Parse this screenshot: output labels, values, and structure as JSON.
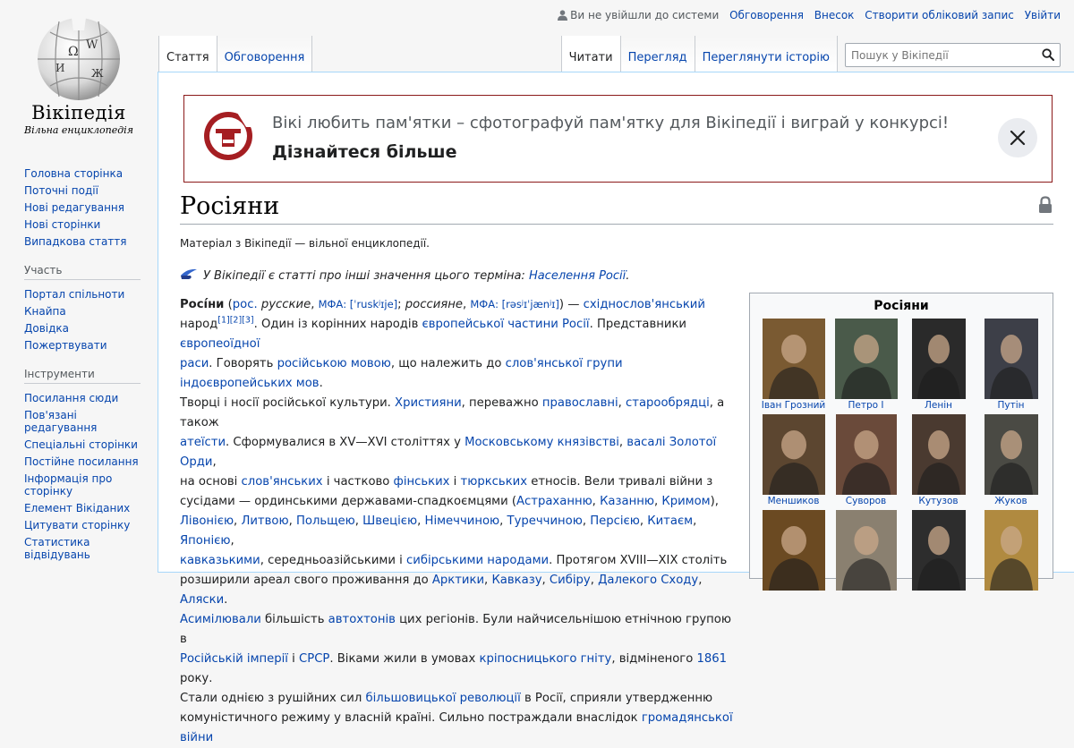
{
  "logo": {
    "wordmark": "Вікіпедія",
    "tagline": "Вільна енциклопедія"
  },
  "sidebar": {
    "navigation": [
      "Головна сторінка",
      "Поточні події",
      "Нові редагування",
      "Нові сторінки",
      "Випадкова стаття"
    ],
    "participation": {
      "heading": "Участь",
      "items": [
        "Портал спільноти",
        "Кнайпа",
        "Довідка",
        "Пожертвувати"
      ]
    },
    "tools": {
      "heading": "Інструменти",
      "items": [
        "Посилання сюди",
        "Пов'язані редагування",
        "Спеціальні сторінки",
        "Постійне посилання",
        "Інформація про сторінку",
        "Елемент Вікіданих",
        "Цитувати сторінку",
        "Статистика відвідувань"
      ]
    }
  },
  "personal": {
    "not_logged_in": "Ви не увійшли до системи",
    "talk": "Обговорення",
    "contributions": "Внесок",
    "create_account": "Створити обліковий запис",
    "log_in": "Увійти"
  },
  "tabs": {
    "article": "Стаття",
    "talk": "Обговорення",
    "read": "Читати",
    "view_source": "Перегляд",
    "history": "Переглянути історію"
  },
  "search": {
    "placeholder": "Пошук у Вікіпедії"
  },
  "banner": {
    "text": "Вікі любить пам'ятки – сфотографуй пам'ятку для Вікіпедії і виграй у конкурсі!",
    "link": "Дізнайтеся більше"
  },
  "page": {
    "title": "Росіяни",
    "from": "Матеріал з Вікіпедії — вільної енциклопедії.",
    "hatnote_prefix": "У Вікіпедії є статті про інші значення цього терміна: ",
    "hatnote_link": "Населення Росії",
    "hatnote_suffix": "."
  },
  "article": {
    "l1": [
      {
        "t": "Росі́́ни",
        "b": true
      },
      {
        "t": " ("
      },
      {
        "t": "рос.",
        "l": true
      },
      {
        "t": " "
      },
      {
        "t": "русские",
        "i": true
      },
      {
        "t": ", "
      },
      {
        "t": "МФА: [ˈruskʲɪje]",
        "l": true,
        "s": true
      },
      {
        "t": "; "
      },
      {
        "t": "россияне",
        "i": true
      },
      {
        "t": ", "
      },
      {
        "t": "МФА: [rəsʲɪˈjænʲɪ]",
        "l": true,
        "s": true
      },
      {
        "t": ") — "
      },
      {
        "t": "східнослов'янський",
        "l": true
      }
    ],
    "l2": [
      {
        "t": "народ"
      },
      {
        "t": "[1][2][3]",
        "l": true,
        "sup": true
      },
      {
        "t": ". Один із корінних народів "
      },
      {
        "t": "європейської частини Росії",
        "l": true
      },
      {
        "t": ". Представники "
      },
      {
        "t": "європеоїдної",
        "l": true
      }
    ],
    "l3": [
      {
        "t": "раси",
        "l": true
      },
      {
        "t": ". Говорять "
      },
      {
        "t": "російською мовою",
        "l": true
      },
      {
        "t": ", що належить до "
      },
      {
        "t": "слов'янської групи",
        "l": true
      },
      {
        "t": " "
      },
      {
        "t": "індоєвропейських мов",
        "l": true
      },
      {
        "t": "."
      }
    ],
    "l4": [
      {
        "t": "Творці і носії російської культури. "
      },
      {
        "t": "Християни",
        "l": true
      },
      {
        "t": ", переважно "
      },
      {
        "t": "православні",
        "l": true
      },
      {
        "t": ", "
      },
      {
        "t": "старообрядці",
        "l": true
      },
      {
        "t": ", а також"
      }
    ],
    "l5": [
      {
        "t": "атеїсти",
        "l": true
      },
      {
        "t": ". Сформувалися в XV—XVI століттях у "
      },
      {
        "t": "Московському князівстві",
        "l": true
      },
      {
        "t": ", "
      },
      {
        "t": "васалі Золотої Орди",
        "l": true
      },
      {
        "t": ","
      }
    ],
    "l6": [
      {
        "t": "на основі "
      },
      {
        "t": "слов'янських",
        "l": true
      },
      {
        "t": " і частково "
      },
      {
        "t": "фінських",
        "l": true
      },
      {
        "t": " і "
      },
      {
        "t": "тюркських",
        "l": true
      },
      {
        "t": " етносів. Вели тривалі війни з"
      }
    ],
    "l7": [
      {
        "t": "сусідами — ординськими державами-спадкоємцями ("
      },
      {
        "t": "Астраханню",
        "l": true
      },
      {
        "t": ", "
      },
      {
        "t": "Казанню",
        "l": true
      },
      {
        "t": ", "
      },
      {
        "t": "Кримом",
        "l": true
      },
      {
        "t": "),"
      }
    ],
    "l8": [
      {
        "t": "Лівонією",
        "l": true
      },
      {
        "t": ", "
      },
      {
        "t": "Литвою",
        "l": true
      },
      {
        "t": ", "
      },
      {
        "t": "Польщею",
        "l": true
      },
      {
        "t": ", "
      },
      {
        "t": "Швецією",
        "l": true
      },
      {
        "t": ", "
      },
      {
        "t": "Німеччиною",
        "l": true
      },
      {
        "t": ", "
      },
      {
        "t": "Туреччиною",
        "l": true
      },
      {
        "t": ", "
      },
      {
        "t": "Персією",
        "l": true
      },
      {
        "t": ", "
      },
      {
        "t": "Китаєм",
        "l": true
      },
      {
        "t": ", "
      },
      {
        "t": "Японією",
        "l": true
      },
      {
        "t": ","
      }
    ],
    "l9": [
      {
        "t": "кавказькими",
        "l": true
      },
      {
        "t": ", середньоазійськими і "
      },
      {
        "t": "сибірськими народами",
        "l": true
      },
      {
        "t": ". Протягом XVIII—XIX століть"
      }
    ],
    "l10": [
      {
        "t": "розширили ареал свого проживання до "
      },
      {
        "t": "Арктики",
        "l": true
      },
      {
        "t": ", "
      },
      {
        "t": "Кавказу",
        "l": true
      },
      {
        "t": ", "
      },
      {
        "t": "Сибіру",
        "l": true
      },
      {
        "t": ", "
      },
      {
        "t": "Далекого Сходу",
        "l": true
      },
      {
        "t": ", "
      },
      {
        "t": "Аляски",
        "l": true
      },
      {
        "t": "."
      }
    ],
    "l11": [
      {
        "t": "Асимілювали",
        "l": true
      },
      {
        "t": " більшість "
      },
      {
        "t": "автохтонів",
        "l": true
      },
      {
        "t": " цих регіонів. Були найчисельнішою етнічною групою в"
      }
    ],
    "l12": [
      {
        "t": "Російській імперії",
        "l": true
      },
      {
        "t": " і "
      },
      {
        "t": "СРСР",
        "l": true
      },
      {
        "t": ". Віками жили в умовах "
      },
      {
        "t": "кріпосницького гніту",
        "l": true
      },
      {
        "t": ", відміненого "
      },
      {
        "t": "1861",
        "l": true
      },
      {
        "t": " року."
      }
    ],
    "l13": [
      {
        "t": "Стали однією з рушійних сил "
      },
      {
        "t": "більшовицької революції",
        "l": true
      },
      {
        "t": " в Росії, сприяли утвердженню"
      }
    ],
    "l14": [
      {
        "t": "комуністичного режиму у власній країні. Сильно постраждали внаслідок "
      },
      {
        "t": "громадянської війни",
        "l": true
      }
    ]
  },
  "infobox": {
    "title": "Росіяни",
    "people": [
      {
        "name": "Іван Грозний",
        "tone": "#7a5a32"
      },
      {
        "name": "Петро I",
        "tone": "#4a5a4a"
      },
      {
        "name": "Ленін",
        "tone": "#2a2a2a"
      },
      {
        "name": "Путін",
        "tone": "#3d3f48"
      },
      {
        "name": "Меншиков",
        "tone": "#5c4630"
      },
      {
        "name": "Суворов",
        "tone": "#6a4a3a"
      },
      {
        "name": "Кутузов",
        "tone": "#4a3a30"
      },
      {
        "name": "Жуков",
        "tone": "#4a4a44"
      },
      {
        "name": "",
        "tone": "#6b4a22"
      },
      {
        "name": "",
        "tone": "#8a8070"
      },
      {
        "name": "",
        "tone": "#2d2d2d"
      },
      {
        "name": "",
        "tone": "#b08a40"
      }
    ]
  },
  "colors": {
    "link": "#0645ad",
    "banner_border": "#8b1a1a"
  }
}
